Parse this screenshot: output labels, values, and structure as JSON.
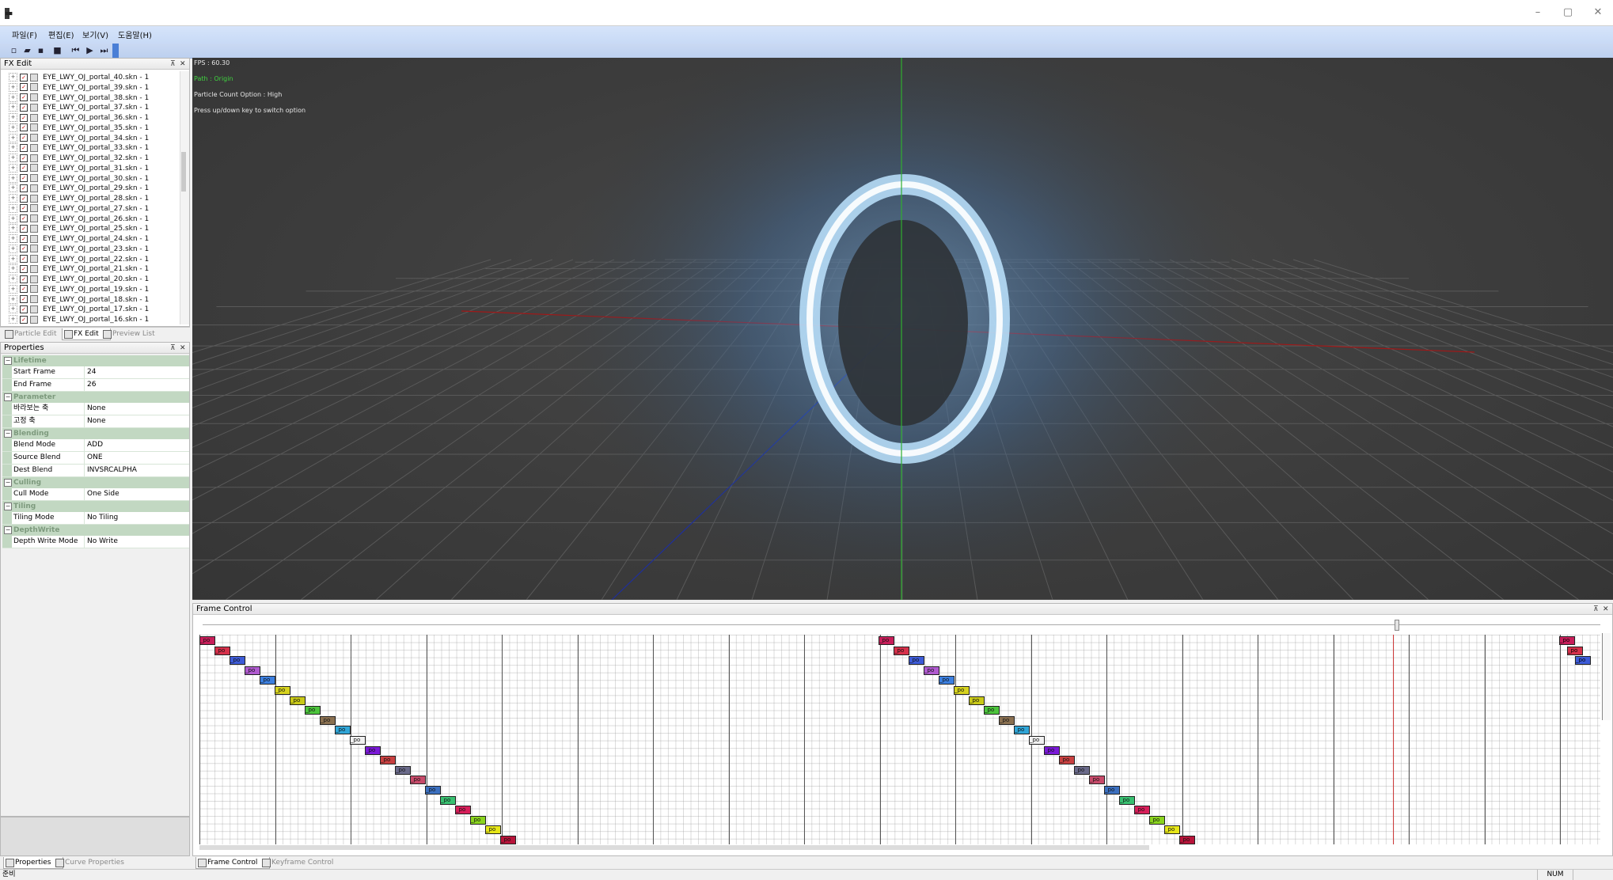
{
  "window": {
    "title": "▬"
  },
  "menu": [
    "파일(F)",
    "편집(E)",
    "보기(V)",
    "도움말(H)"
  ],
  "fx_panel": {
    "title": "FX Edit",
    "items": [
      "EYE_LWY_OJ_portal_40.skn - 1",
      "EYE_LWY_OJ_portal_39.skn - 1",
      "EYE_LWY_OJ_portal_38.skn - 1",
      "EYE_LWY_OJ_portal_37.skn - 1",
      "EYE_LWY_OJ_portal_36.skn - 1",
      "EYE_LWY_OJ_portal_35.skn - 1",
      "EYE_LWY_OJ_portal_34.skn - 1",
      "EYE_LWY_OJ_portal_33.skn - 1",
      "EYE_LWY_OJ_portal_32.skn - 1",
      "EYE_LWY_OJ_portal_31.skn - 1",
      "EYE_LWY_OJ_portal_30.skn - 1",
      "EYE_LWY_OJ_portal_29.skn - 1",
      "EYE_LWY_OJ_portal_28.skn - 1",
      "EYE_LWY_OJ_portal_27.skn - 1",
      "EYE_LWY_OJ_portal_26.skn - 1",
      "EYE_LWY_OJ_portal_25.skn - 1",
      "EYE_LWY_OJ_portal_24.skn - 1",
      "EYE_LWY_OJ_portal_23.skn - 1",
      "EYE_LWY_OJ_portal_22.skn - 1",
      "EYE_LWY_OJ_portal_21.skn - 1",
      "EYE_LWY_OJ_portal_20.skn - 1",
      "EYE_LWY_OJ_portal_19.skn - 1",
      "EYE_LWY_OJ_portal_18.skn - 1",
      "EYE_LWY_OJ_portal_17.skn - 1",
      "EYE_LWY_OJ_portal_16.skn - 1"
    ],
    "tabs": [
      "Particle Edit",
      "FX Edit",
      "Preview List"
    ]
  },
  "properties": {
    "title": "Properties",
    "categories": [
      {
        "name": "Lifetime",
        "rows": [
          [
            "Start Frame",
            "24"
          ],
          [
            "End Frame",
            "26"
          ]
        ]
      },
      {
        "name": "Parameter",
        "rows": [
          [
            "바라보는 축",
            "None"
          ],
          [
            "고정 축",
            "None"
          ]
        ]
      },
      {
        "name": "Blending",
        "rows": [
          [
            "Blend Mode",
            "ADD"
          ],
          [
            "Source Blend",
            "ONE"
          ],
          [
            "Dest Blend",
            "INVSRCALPHA"
          ]
        ]
      },
      {
        "name": "Culling",
        "rows": [
          [
            "Cull Mode",
            "One Side"
          ]
        ]
      },
      {
        "name": "Tiling",
        "rows": [
          [
            "Tiling Mode",
            "No Tiling"
          ]
        ]
      },
      {
        "name": "DepthWrite",
        "rows": [
          [
            "Depth Write Mode",
            "No Write"
          ]
        ]
      }
    ],
    "tabs": [
      "Properties",
      "Curve Properties"
    ]
  },
  "viewport": {
    "fps": "FPS : 60.30",
    "path": "Path : Origin",
    "particle_option": "Particle Count Option : High",
    "hint": "Press up/down key to switch option"
  },
  "frame_control": {
    "title": "Frame Control",
    "key_label": "_po",
    "tabs": [
      "Frame Control",
      "Keyframe Control"
    ],
    "key_colors": [
      "#c81e5a",
      "#d6304a",
      "#3d5bd8",
      "#b05ad0",
      "#3b7fe0",
      "#d6d21e",
      "#c9c918",
      "#4cc43c",
      "#8a7050",
      "#30a6d8",
      "#f0f0f0",
      "#7a18d8",
      "#c94040",
      "#6a6a8a",
      "#c84a6a",
      "#3c70c0",
      "#38c070",
      "#d81e5a",
      "#8ad41e",
      "#e6e618",
      "#b8143a"
    ]
  },
  "status": {
    "left": "준비",
    "num": "NUM"
  }
}
